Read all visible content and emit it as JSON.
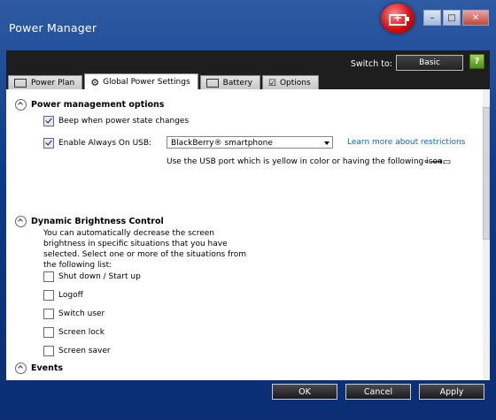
{
  "window": {
    "title": "Power Manager"
  },
  "header": {
    "switch_to_label": "Switch to:",
    "basic_button": "Basic",
    "help_icon_glyph": "?"
  },
  "tabs": [
    {
      "label": "Power Plan",
      "icon": "battery-icon"
    },
    {
      "label": "Global Power Settings",
      "icon": "gear-icon",
      "active": true
    },
    {
      "label": "Battery",
      "icon": "battery-icon"
    },
    {
      "label": "Options",
      "icon": "checkbox-icon"
    }
  ],
  "power_management": {
    "title": "Power management options",
    "beep_label": "Beep when power state changes",
    "beep_checked": true,
    "always_on_usb_label": "Enable Always On USB:",
    "always_on_usb_checked": true,
    "usb_device_selected": "BlackBerry® smartphone",
    "learn_more_link": "Learn more about restrictions",
    "usb_note": "Use the USB port which is yellow in color or having the following icon."
  },
  "brightness": {
    "title": "Dynamic Brightness Control",
    "description": "You can automatically decrease the screen brightness in specific situations that you have selected. Select one or more of the situations from the following list:",
    "items": [
      {
        "label": "Shut down / Start up",
        "checked": false
      },
      {
        "label": "Logoff",
        "checked": false
      },
      {
        "label": "Switch user",
        "checked": false
      },
      {
        "label": "Screen lock",
        "checked": false
      },
      {
        "label": "Screen saver",
        "checked": false
      }
    ]
  },
  "events": {
    "title": "Events"
  },
  "footer": {
    "ok": "OK",
    "cancel": "Cancel",
    "apply": "Apply"
  },
  "colors": {
    "link": "#1466c8",
    "title_bar": "#0d3a8a",
    "help_green": "#4e8e16",
    "logo_red": "#d80e0e"
  }
}
